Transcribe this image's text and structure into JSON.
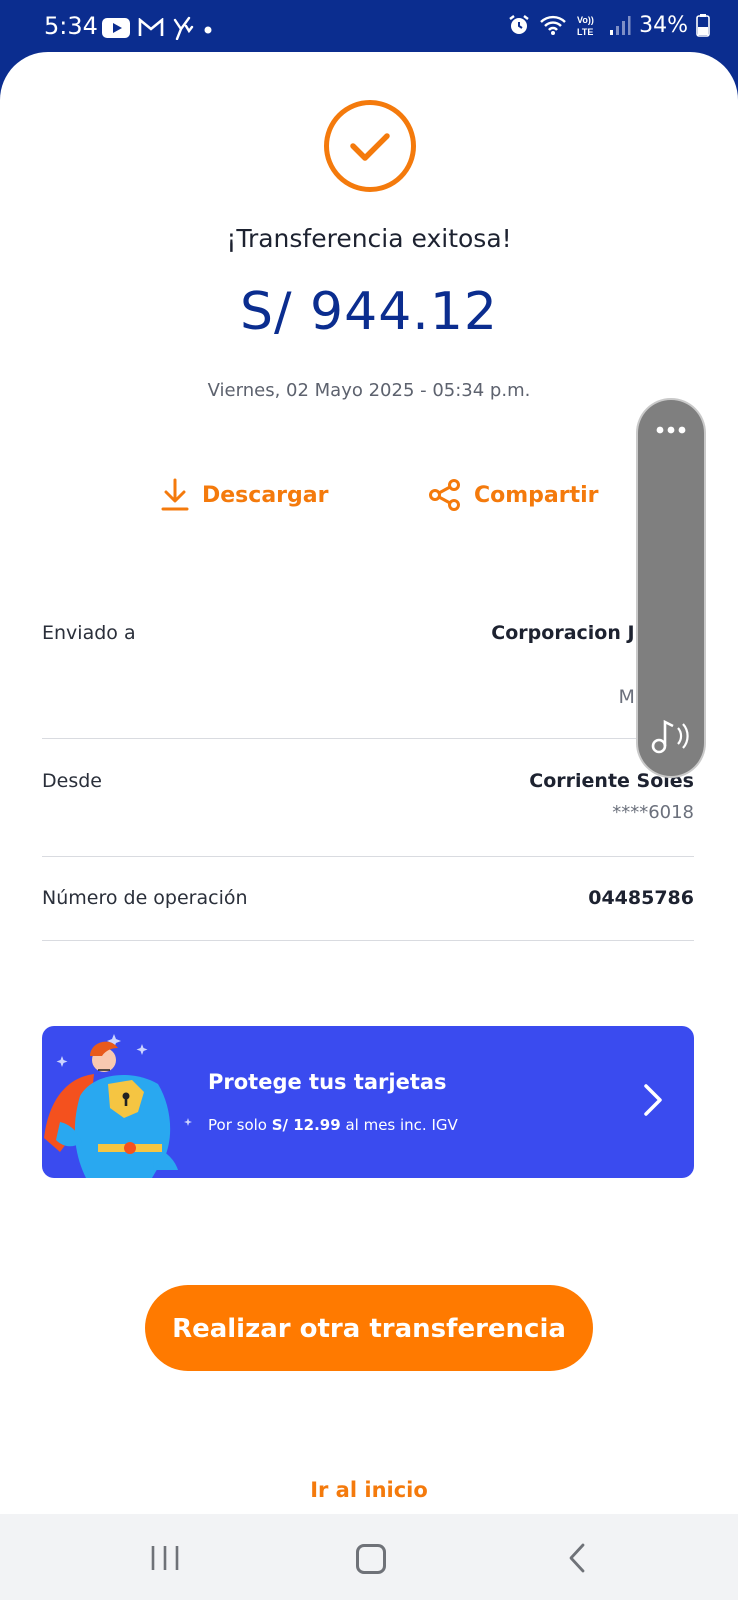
{
  "status_bar": {
    "time": "5:34",
    "battery": "34%",
    "left_icons": [
      "youtube-icon",
      "gmail-icon",
      "yape-icon",
      "dot-icon"
    ],
    "right_icons": [
      "alarm-icon",
      "wifi-icon",
      "volte-icon",
      "signal-icon",
      "battery-icon"
    ]
  },
  "receipt": {
    "title": "¡Transferencia exitosa!",
    "amount": "S/ 944.12",
    "date": "Viernes, 02 Mayo 2025 - 05:34 p.m.",
    "status_icon": "check-circle-icon",
    "accent_color": "#f47a0c",
    "brand_color": "#0b2d8f"
  },
  "actions": {
    "download_label": "Descargar",
    "share_label": "Compartir"
  },
  "details": {
    "sent_to_label": "Enviado a",
    "sent_to_name": "Corporacion Juanjo",
    "sent_to_account": "***",
    "sent_to_currency": "Moneda",
    "from_label": "Desde",
    "from_account_name": "Corriente Soles",
    "from_account_number": "****6018",
    "operation_label": "Número de operación",
    "operation_number": "04485786"
  },
  "banner": {
    "title": "Protege tus tarjetas",
    "sub_prefix": "Por solo ",
    "sub_price": "S/ 12.99",
    "sub_suffix": " al mes inc. IGV",
    "background_color": "#3a4bef"
  },
  "buttons": {
    "primary": "Realizar otra transferencia",
    "home_link": "Ir al inicio"
  },
  "floating_widget": {
    "icons": [
      "more-dots-icon",
      "music-sound-icon"
    ]
  },
  "navbar": {
    "icons": [
      "recent-apps-icon",
      "home-icon",
      "back-icon"
    ]
  }
}
